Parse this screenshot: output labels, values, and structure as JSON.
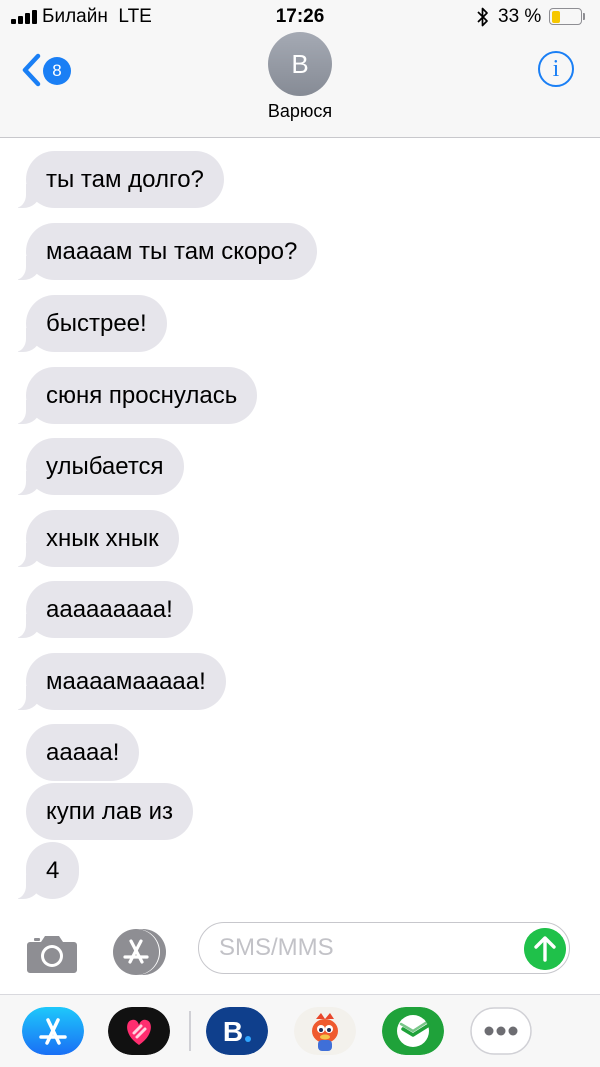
{
  "status_bar": {
    "carrier": "Билайн",
    "network": "LTE",
    "time": "17:26",
    "battery_percent": "33 %",
    "battery_level": 0.33,
    "icons": [
      "signal-icon",
      "bluetooth-icon",
      "battery-icon"
    ]
  },
  "header": {
    "back_badge": "8",
    "avatar_initial": "В",
    "contact_name": "Варюся",
    "info_label": "i"
  },
  "messages": [
    "ты там долго?",
    "мааaам ты там скоро?",
    "быстрее!",
    "сюня проснулась",
    "улыбается",
    "хнык хнык",
    "ааааааааа!",
    "маааамааааа!",
    "ааааа!",
    "купи лав из",
    "4"
  ],
  "composer": {
    "placeholder": "SMS/MMS",
    "value": ""
  },
  "colors": {
    "accent": "#1a7ff5",
    "bubble": "#e6e5eb",
    "send": "#1fc14a",
    "battery_fill": "#f6c700"
  },
  "app_drawer": [
    "app-store-icon",
    "digital-touch-icon",
    "booking-icon",
    "game-character-icon",
    "sberbank-icon",
    "more-icon"
  ]
}
